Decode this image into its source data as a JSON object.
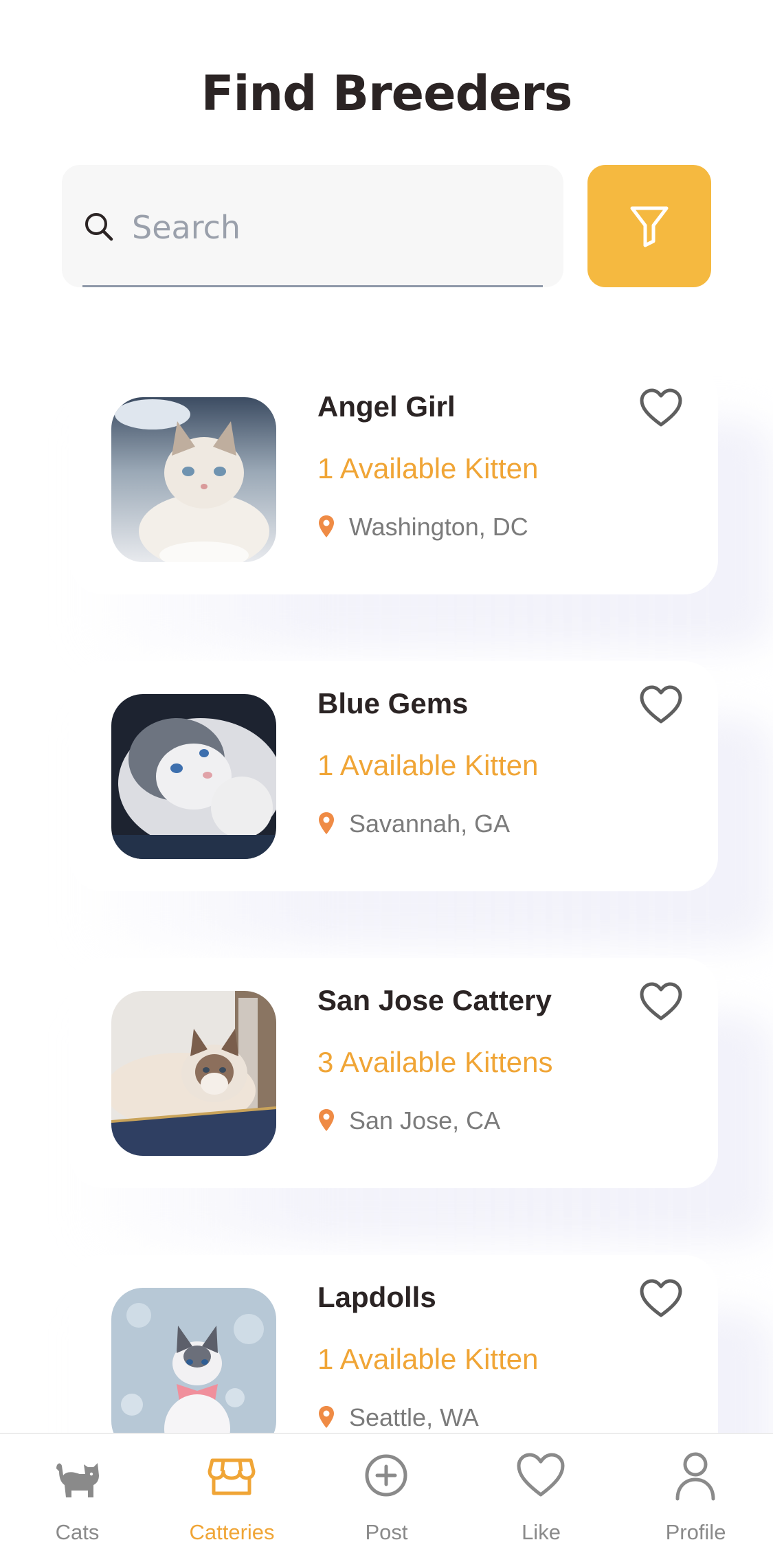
{
  "header": {
    "title": "Find Breeders"
  },
  "search": {
    "placeholder": "Search",
    "value": ""
  },
  "colors": {
    "accent": "#f5b940",
    "available_text": "#f0a536",
    "location_pin": "#ef8b45",
    "heart_outline": "#5f5f5f",
    "inactive_tab": "#8a8a8a"
  },
  "breeders": [
    {
      "name": "Angel Girl",
      "available": "1 Available Kitten",
      "location": "Washington, DC",
      "photo_icon": "cat-photo-ragdoll-sitting"
    },
    {
      "name": "Blue Gems",
      "available": "1 Available Kitten",
      "location": "Savannah, GA",
      "photo_icon": "cat-photo-ragdoll-lying"
    },
    {
      "name": "San Jose Cattery",
      "available": "3 Available Kittens",
      "location": "San Jose, CA",
      "photo_icon": "cat-photo-ragdoll-on-box"
    },
    {
      "name": "Lapdolls",
      "available": "1 Available Kitten",
      "location": "Seattle, WA",
      "photo_icon": "cat-photo-ragdoll-bow"
    }
  ],
  "tab_bar": {
    "active": "Catteries",
    "items": [
      {
        "label": "Cats",
        "icon": "cat-icon"
      },
      {
        "label": "Catteries",
        "icon": "store-icon"
      },
      {
        "label": "Post",
        "icon": "plus-circle-icon"
      },
      {
        "label": "Like",
        "icon": "heart-icon"
      },
      {
        "label": "Profile",
        "icon": "person-icon"
      }
    ]
  }
}
